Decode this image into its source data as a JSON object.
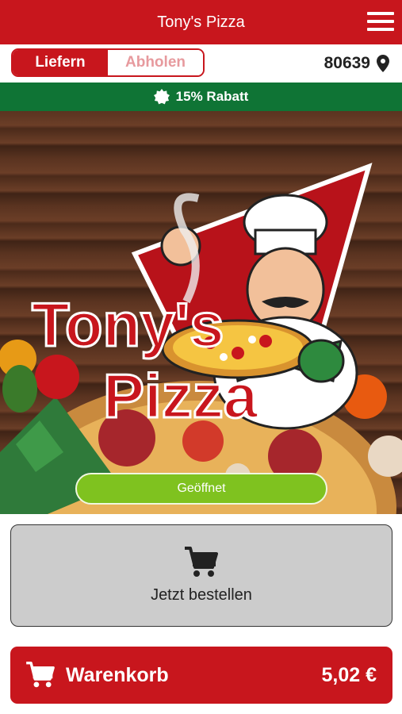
{
  "header": {
    "title": "Tony's Pizza",
    "menu_icon": "hamburger-menu-icon"
  },
  "mode": {
    "options": [
      {
        "label": "Liefern",
        "active": true
      },
      {
        "label": "Abholen",
        "active": false
      }
    ]
  },
  "location": {
    "zip": "80639",
    "icon": "map-pin-icon"
  },
  "promo": {
    "text": "15% Rabatt",
    "icon": "discount-badge-icon"
  },
  "hero": {
    "logo_line1": "Tony's",
    "logo_line2": "Pizza",
    "status_label": "Geöffnet"
  },
  "order": {
    "label": "Jetzt bestellen",
    "icon": "shopping-cart-icon"
  },
  "cart": {
    "label": "Warenkorb",
    "amount": "5,02 €",
    "icon": "shopping-cart-icon"
  },
  "colors": {
    "brand_red": "#c8161d",
    "promo_green": "#0f7435",
    "open_green": "#7fc21f"
  }
}
